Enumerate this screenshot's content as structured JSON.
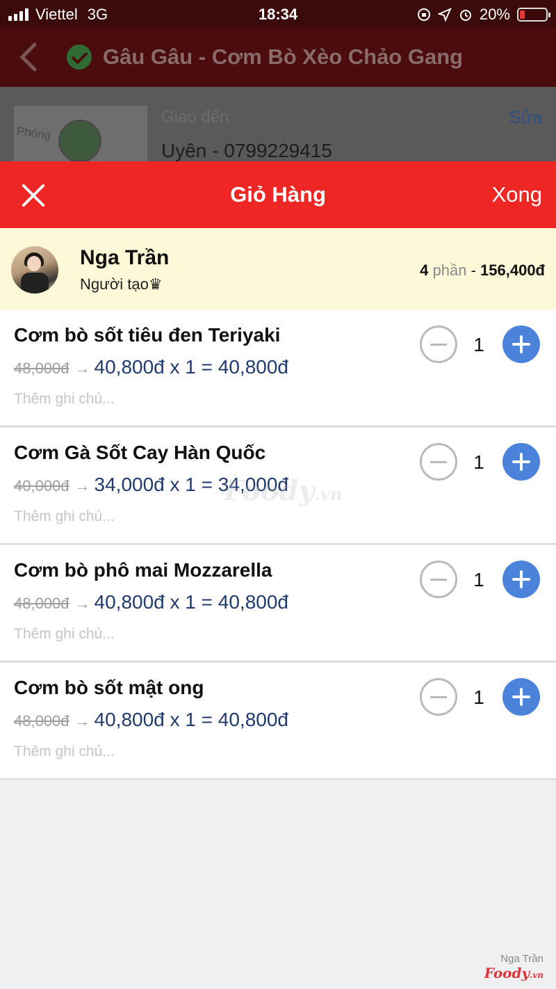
{
  "status_bar": {
    "carrier": "Viettel",
    "network": "3G",
    "time": "18:34",
    "battery_percent": "20%",
    "battery_level": 0.2
  },
  "background": {
    "restaurant_title": "Gâu Gâu - Cơm Bò Xèo Chảo Gang",
    "deliver_label": "Giao đến",
    "deliver_to": "Uyên - 0799229415",
    "edit_label": "Sửa",
    "map_label": "Phóng"
  },
  "cart": {
    "title": "Giỏ Hàng",
    "done_label": "Xong"
  },
  "owner": {
    "name": "Nga Trần",
    "role": "Người tạo♛",
    "count": "4",
    "count_unit": "phần",
    "separator": "-",
    "total": "156,400đ"
  },
  "items": [
    {
      "name": "Cơm bò sốt tiêu đen Teriyaki",
      "old_price": "48,000đ",
      "arrow": "→",
      "price_line": "40,800đ x 1 = 40,800đ",
      "note_placeholder": "Thêm ghi chú...",
      "qty": "1"
    },
    {
      "name": "Cơm Gà Sốt Cay Hàn Quốc",
      "old_price": "40,000đ",
      "arrow": "→",
      "price_line": "34,000đ x 1 = 34,000đ",
      "note_placeholder": "Thêm ghi chú...",
      "qty": "1"
    },
    {
      "name": "Cơm bò phô mai Mozzarella",
      "old_price": "48,000đ",
      "arrow": "→",
      "price_line": "40,800đ x 1 = 40,800đ",
      "note_placeholder": "Thêm ghi chú...",
      "qty": "1"
    },
    {
      "name": "Cơm bò sốt mật ong",
      "old_price": "48,000đ",
      "arrow": "→",
      "price_line": "40,800đ x 1 = 40,800đ",
      "note_placeholder": "Thêm ghi chú...",
      "qty": "1"
    }
  ],
  "watermark": {
    "center_brand": "Foody",
    "center_suffix": ".vn",
    "corner_name": "Nga Trần",
    "corner_brand": "Foody",
    "corner_suffix": ".vn"
  },
  "icons": {
    "close": "close-icon",
    "minus": "minus-icon",
    "plus": "plus-icon",
    "back": "chevron-left-icon",
    "verified": "check-circle-icon",
    "location": "location-arrow-icon",
    "alarm": "alarm-icon",
    "rotation_lock": "rotation-lock-icon"
  },
  "colors": {
    "header_red": "#ee2624",
    "owner_bg": "#fcf8d8",
    "plus_blue": "#4a83d9",
    "price_navy": "#213a6d"
  }
}
